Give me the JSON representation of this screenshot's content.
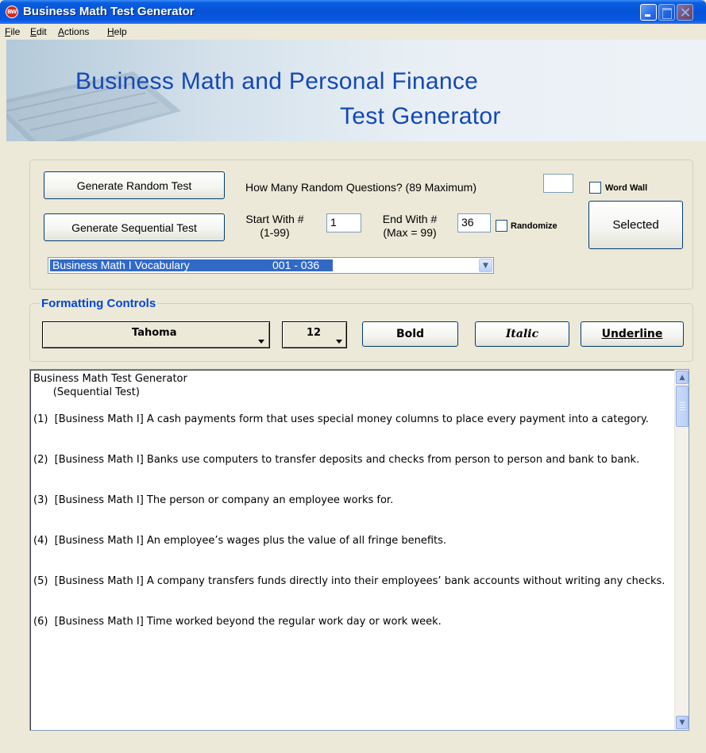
{
  "window": {
    "title": "Business Math Test Generator",
    "app_icon_text": "BW"
  },
  "menu": {
    "items": [
      {
        "key": "F",
        "rest": "ile"
      },
      {
        "key": "E",
        "rest": "dit"
      },
      {
        "key": "A",
        "rest": "ctions"
      },
      {
        "key": "H",
        "rest": "elp"
      }
    ]
  },
  "banner": {
    "line1": "Business Math and Personal Finance",
    "line2": "Test Generator"
  },
  "generate": {
    "random_button": "Generate Random Test",
    "sequential_button": "Generate Sequential Test",
    "how_many_label": "How Many Random Questions? (89 Maximum)",
    "how_many_value": "",
    "word_wall_label": "Word Wall",
    "word_wall_checked": false,
    "start_label_line1": "Start With #",
    "start_label_line2": "(1-99)",
    "start_value": "1",
    "end_label_line1": "End With #",
    "end_label_line2": "(Max = 99)",
    "end_value": "36",
    "randomize_label": "Randomize",
    "randomize_checked": false,
    "selected_button": "Selected",
    "category_name": "Business Math I Vocabulary",
    "category_range": "001 - 036"
  },
  "formatting": {
    "legend": "Formatting Controls",
    "font_value": "Tahoma",
    "size_value": "12",
    "bold_button": "Bold",
    "italic_button": "Italic",
    "underline_button": "Underline"
  },
  "output": {
    "header_line1": "Business Math Test Generator",
    "header_line2": "      (Sequential Test)",
    "questions": [
      "(1)  [Business Math I] A cash payments form that uses special money columns to place every payment into a category.",
      "(2)  [Business Math I] Banks use computers to transfer deposits and checks from person to person and bank to bank.",
      "(3)  [Business Math I] The person or company an employee works for.",
      "(4)  [Business Math I] An employee’s wages plus the value of all fringe benefits.",
      "(5)  [Business Math I] A company transfers funds directly into their employees’ bank accounts without writing any checks.",
      "(6)  [Business Math I] Time worked beyond the regular work day or work week."
    ]
  },
  "colors": {
    "title_bar": "#0653d8",
    "banner_text": "#1448b8",
    "legend_text": "#0046d5",
    "selection": "#316ac5",
    "window_bg": "#ece9d8"
  }
}
